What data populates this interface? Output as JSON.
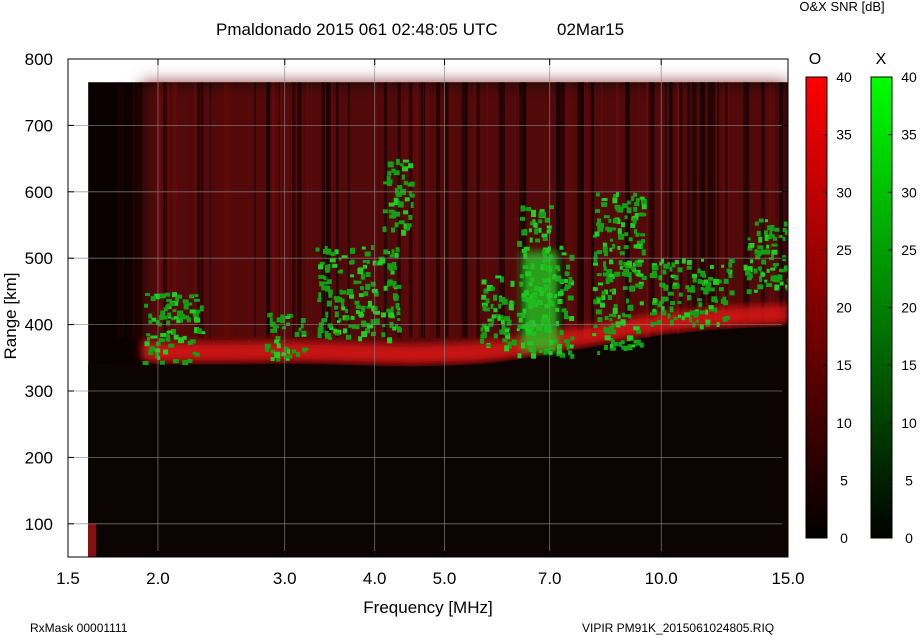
{
  "header": {
    "title": "Pmaldonado 2015 061 02:48:05 UTC",
    "date": "02Mar15",
    "colorbar_title": "O&X SNR [dB]"
  },
  "footer": {
    "left": "RxMask 00001111",
    "right": "VIPIR  PM91K_2015061024805.RIQ"
  },
  "chart_data": {
    "type": "heatmap",
    "title": "Pmaldonado 2015 061 02:48:05 UTC",
    "xlabel": "Frequency [MHz]",
    "ylabel": "Range [km]",
    "x_scale": "log",
    "xlim": [
      1.5,
      15.0
    ],
    "ylim": [
      50,
      800
    ],
    "x_ticks": [
      1.5,
      2.0,
      3.0,
      4.0,
      5.0,
      7.0,
      10.0,
      15.0
    ],
    "x_tick_labels": [
      "1.5",
      "2.0",
      "3.0",
      "4.0",
      "5.0",
      "7.0",
      "10.0",
      "15.0"
    ],
    "y_ticks": [
      100,
      200,
      300,
      400,
      500,
      600,
      700,
      800
    ],
    "y_tick_labels": [
      "100",
      "200",
      "300",
      "400",
      "500",
      "600",
      "700",
      "800"
    ],
    "grid": true,
    "data_range": {
      "freq_mhz": [
        1.6,
        15.0
      ],
      "range_km": [
        50,
        765
      ]
    },
    "colorbars": [
      {
        "name": "O",
        "color": "#ff0000",
        "min": 0,
        "max": 40,
        "tick_labels": [
          "0",
          "5",
          "10",
          "15",
          "20",
          "25",
          "30",
          "35",
          "40"
        ]
      },
      {
        "name": "X",
        "color": "#00ff00",
        "min": 0,
        "max": 40,
        "tick_labels": [
          "0",
          "5",
          "10",
          "15",
          "20",
          "25",
          "30",
          "35",
          "40"
        ]
      }
    ],
    "o_mode_trace": [
      {
        "freq": 1.9,
        "range": 355
      },
      {
        "freq": 2.0,
        "range": 352
      },
      {
        "freq": 2.5,
        "range": 352
      },
      {
        "freq": 3.0,
        "range": 353
      },
      {
        "freq": 3.5,
        "range": 352
      },
      {
        "freq": 4.0,
        "range": 350
      },
      {
        "freq": 4.5,
        "range": 349
      },
      {
        "freq": 5.0,
        "range": 350
      },
      {
        "freq": 5.5,
        "range": 352
      },
      {
        "freq": 6.0,
        "range": 356
      },
      {
        "freq": 6.5,
        "range": 362
      },
      {
        "freq": 7.0,
        "range": 368
      },
      {
        "freq": 8.0,
        "range": 378
      },
      {
        "freq": 9.0,
        "range": 388
      },
      {
        "freq": 10.0,
        "range": 396
      },
      {
        "freq": 12.0,
        "range": 405
      },
      {
        "freq": 15.0,
        "range": 410
      }
    ],
    "x_mode_clusters": [
      {
        "freq": [
          1.9,
          2.3
        ],
        "range": [
          345,
          450
        ]
      },
      {
        "freq": [
          2.8,
          3.2
        ],
        "range": [
          350,
          420
        ]
      },
      {
        "freq": [
          3.3,
          4.3
        ],
        "range": [
          380,
          520
        ]
      },
      {
        "freq": [
          4.1,
          4.5
        ],
        "range": [
          540,
          650
        ]
      },
      {
        "freq": [
          5.6,
          6.2
        ],
        "range": [
          360,
          480
        ]
      },
      {
        "freq": [
          6.3,
          7.5
        ],
        "range": [
          355,
          520
        ]
      },
      {
        "freq": [
          6.3,
          7.0
        ],
        "range": [
          520,
          580
        ]
      },
      {
        "freq": [
          8.0,
          9.4
        ],
        "range": [
          360,
          600
        ]
      },
      {
        "freq": [
          9.6,
          12.5
        ],
        "range": [
          400,
          500
        ]
      },
      {
        "freq": [
          13.0,
          15.0
        ],
        "range": [
          450,
          560
        ]
      }
    ]
  }
}
